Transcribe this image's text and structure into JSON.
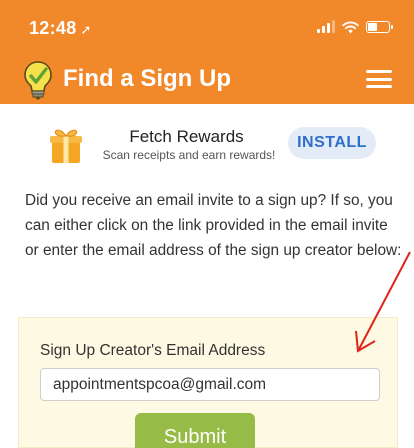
{
  "status_bar": {
    "time": "12:48",
    "location_glyph": "➚",
    "signal_bars": 3,
    "battery_level": 0.45,
    "icons": [
      "signal-icon",
      "wifi-icon",
      "battery-icon"
    ]
  },
  "nav": {
    "title": "Find a Sign Up",
    "logo_icon": "lightbulb-logo-icon",
    "menu_icon": "hamburger-menu-icon"
  },
  "ad": {
    "icon": "gift-box-icon",
    "title": "Fetch Rewards",
    "subtitle": "Scan receipts and earn rewards!",
    "button_label": "INSTALL"
  },
  "description": "Did you receive an email invite to a sign up? If so, you can either click on the link provided in the email invite or enter the email address of the sign up creator below:",
  "form": {
    "label": "Sign Up Creator's Email Address",
    "email_value": "appointmentspcoa@gmail.com",
    "submit_label": "Submit"
  },
  "colors": {
    "header_orange": "#f1882a",
    "install_blue": "#2f6fcb",
    "form_background": "#fdf9e2",
    "submit_green": "#96bb47",
    "annotation_red": "#e0231b"
  }
}
